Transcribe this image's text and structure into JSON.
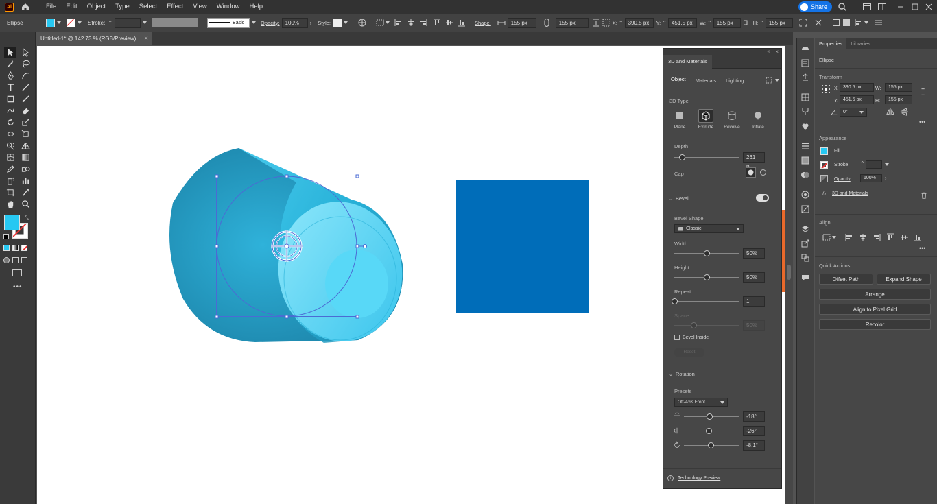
{
  "menu": [
    "File",
    "Edit",
    "Object",
    "Type",
    "Select",
    "Effect",
    "View",
    "Window",
    "Help"
  ],
  "share_label": "Share",
  "control": {
    "object_type": "Ellipse",
    "stroke_label": "Stroke:",
    "brush_label": "Basic",
    "opacity_label": "Opacity:",
    "opacity_value": "100%",
    "style_label": "Style:",
    "shape_label": "Shape:",
    "shape_w": "155 px",
    "shape_h": "155 px",
    "x_label": "X:",
    "x_value": "390.5 px",
    "y_label": "Y:",
    "y_value": "451.5 px",
    "w_label": "W:",
    "w_value": "155 px",
    "h_label": "H:",
    "h_value": "155 px"
  },
  "doc_tab": {
    "title": "Untitled-1* @ 142.73 % (RGB/Preview)",
    "close": "×"
  },
  "colors": {
    "fill": "#27C8F2",
    "square": "#006DB9",
    "accent": "#1473E6",
    "orange": "#E8692B"
  },
  "panel3d": {
    "title": "3D and Materials",
    "tabs": [
      "Object",
      "Materials",
      "Lighting"
    ],
    "type_label": "3D Type",
    "types": [
      "Plane",
      "Extrude",
      "Revolve",
      "Inflate"
    ],
    "depth_label": "Depth",
    "depth_value": "261 pt",
    "cap_label": "Cap",
    "bevel_label": "Bevel",
    "bevel_shape_label": "Bevel Shape",
    "bevel_shape_value": "Classic",
    "width_label": "Width",
    "width_value": "50%",
    "height_label": "Height",
    "height_value": "50%",
    "repeat_label": "Repeat",
    "repeat_value": "1",
    "space_label": "Space",
    "space_value": "50%",
    "bevel_inside_label": "Bevel Inside",
    "reset_label": "Reset",
    "rotation_label": "Rotation",
    "presets_label": "Presets",
    "presets_value": "Off-Axis Front",
    "rot_x": "-18°",
    "rot_y": "-26°",
    "rot_z": "-8.1°",
    "tech_preview": "Technology Preview",
    "fractions": {
      "depth": 0.12,
      "width": 0.5,
      "height": 0.5,
      "repeat": 0.0,
      "space": 0.3,
      "rot_x": 0.47,
      "rot_y": 0.45,
      "rot_z": 0.49
    }
  },
  "props": {
    "tabs": [
      "Properties",
      "Libraries"
    ],
    "object": "Ellipse",
    "transform_label": "Transform",
    "x_label": "X:",
    "x_value": "390.5 px",
    "y_label": "Y:",
    "y_value": "451.5 px",
    "w_label": "W:",
    "w_value": "155 px",
    "h_label": "H:",
    "h_value": "155 px",
    "angle_value": "0°",
    "appearance_label": "Appearance",
    "fill_label": "Fill",
    "stroke_label": "Stroke",
    "opacity_label": "Opacity",
    "opacity_value": "100%",
    "fx_label": "fx.",
    "effect_label": "3D and Materials",
    "align_label": "Align",
    "quick_label": "Quick Actions",
    "offset_path": "Offset Path",
    "expand_shape": "Expand Shape",
    "arrange": "Arrange",
    "align_pixel": "Align to Pixel Grid",
    "recolor": "Recolor"
  }
}
